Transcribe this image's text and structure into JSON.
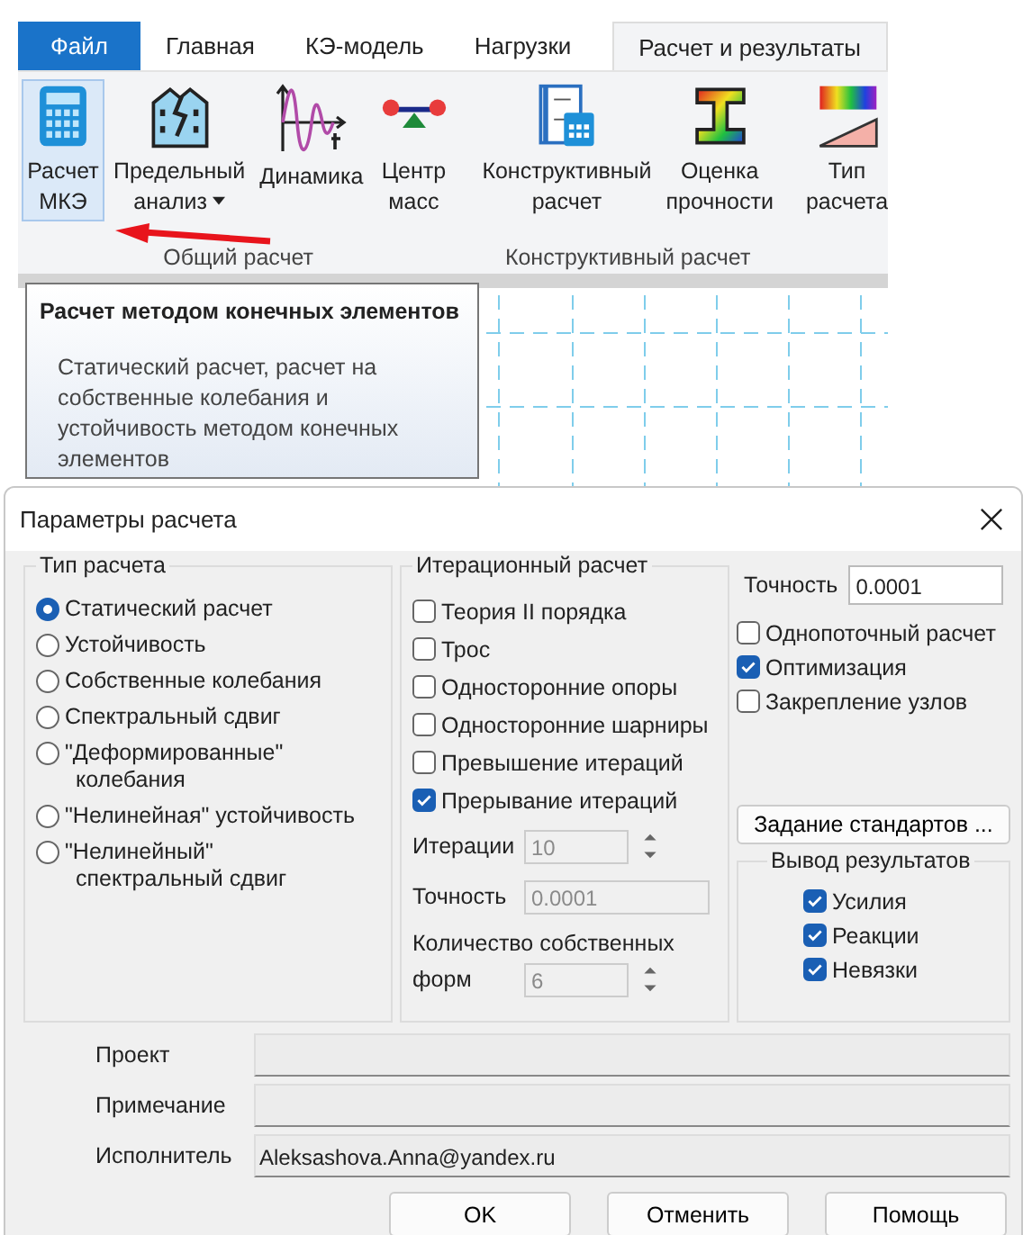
{
  "tabs": [
    {
      "label": "Файл",
      "kind": "file",
      "selected": false
    },
    {
      "label": "Главная",
      "kind": "tab",
      "selected": false
    },
    {
      "label": "КЭ-модель",
      "kind": "tab",
      "selected": false
    },
    {
      "label": "Нагрузки",
      "kind": "tab",
      "selected": false
    },
    {
      "label": "Расчет и результаты",
      "kind": "tab",
      "selected": true
    }
  ],
  "ribbon_groups": [
    {
      "label": "Общий расчет",
      "buttons": [
        {
          "lines": [
            "Расчет",
            "МКЭ"
          ],
          "highlighted": true
        },
        {
          "lines": [
            "Предельный",
            "анализ"
          ],
          "highlighted": false,
          "dropdown": true
        },
        {
          "lines": [
            "Динамика"
          ],
          "highlighted": false
        },
        {
          "lines": [
            "Центр",
            "масс"
          ],
          "highlighted": false
        }
      ]
    },
    {
      "label": "Конструктивный расчет",
      "buttons": [
        {
          "lines": [
            "Конструктивный",
            "расчет"
          ],
          "highlighted": false
        },
        {
          "lines": [
            "Оценка",
            "прочности"
          ],
          "highlighted": false
        }
      ]
    },
    {
      "buttons": [
        {
          "lines": [
            "Тип",
            "расчета"
          ],
          "highlighted": false
        }
      ]
    }
  ],
  "tooltip": {
    "title": "Расчет методом конечных элементов",
    "text": "Статический расчет, расчет на собственные колебания и устойчивость методом конечных элементов"
  },
  "dialog": {
    "title": "Параметры расчета",
    "calc_type": {
      "title": "Тип расчета",
      "options": [
        {
          "lines": [
            "Статический расчет"
          ],
          "selected": true
        },
        {
          "lines": [
            "Устойчивость"
          ],
          "selected": false
        },
        {
          "lines": [
            "Собственные колебания"
          ],
          "selected": false
        },
        {
          "lines": [
            "Спектральный сдвиг"
          ],
          "selected": false
        },
        {
          "lines": [
            "\"Деформированные\"",
            "колебания"
          ],
          "selected": false
        },
        {
          "lines": [
            "\"Нелинейная\" устойчивость"
          ],
          "selected": false
        },
        {
          "lines": [
            "\"Нелинейный\"",
            "спектральный  сдвиг"
          ],
          "selected": false
        }
      ]
    },
    "iteration": {
      "title": "Итерационный расчет",
      "options": [
        {
          "label": "Теория II порядка",
          "checked": false
        },
        {
          "label": "Трос",
          "checked": false
        },
        {
          "label": "Односторонние опоры",
          "checked": false
        },
        {
          "label": "Односторонние шарниры",
          "checked": false
        },
        {
          "label": "Превышение итераций",
          "checked": false
        },
        {
          "label": "Прерывание итераций",
          "checked": true
        }
      ],
      "iterations": {
        "label": "Итерации",
        "value": "10",
        "disabled": true
      },
      "accuracy": {
        "label": "Точность",
        "value": "0.0001",
        "disabled": true
      },
      "modes": {
        "label_line1": "Количество собственных",
        "label_line2": "форм",
        "value": "6",
        "disabled": true
      }
    },
    "accuracy": {
      "label": "Точность",
      "value": "0.0001"
    },
    "options": [
      {
        "label": "Однопоточный расчет",
        "checked": false
      },
      {
        "label": "Оптимизация",
        "checked": true
      },
      {
        "label": "Закрепление узлов",
        "checked": false
      }
    ],
    "standards_button": "Задание стандартов ...",
    "output": {
      "title": "Вывод результатов",
      "options": [
        {
          "label": "Усилия",
          "checked": true
        },
        {
          "label": "Реакции",
          "checked": true
        },
        {
          "label": "Невязки",
          "checked": true
        }
      ]
    },
    "fields": [
      {
        "label": "Проект"
      },
      {
        "label": "Примечание"
      },
      {
        "label": "Исполнитель",
        "value": "Aleksashova.Anna@yandex.ru"
      }
    ],
    "buttons": [
      "OK",
      "Отменить",
      "Помощь"
    ]
  }
}
